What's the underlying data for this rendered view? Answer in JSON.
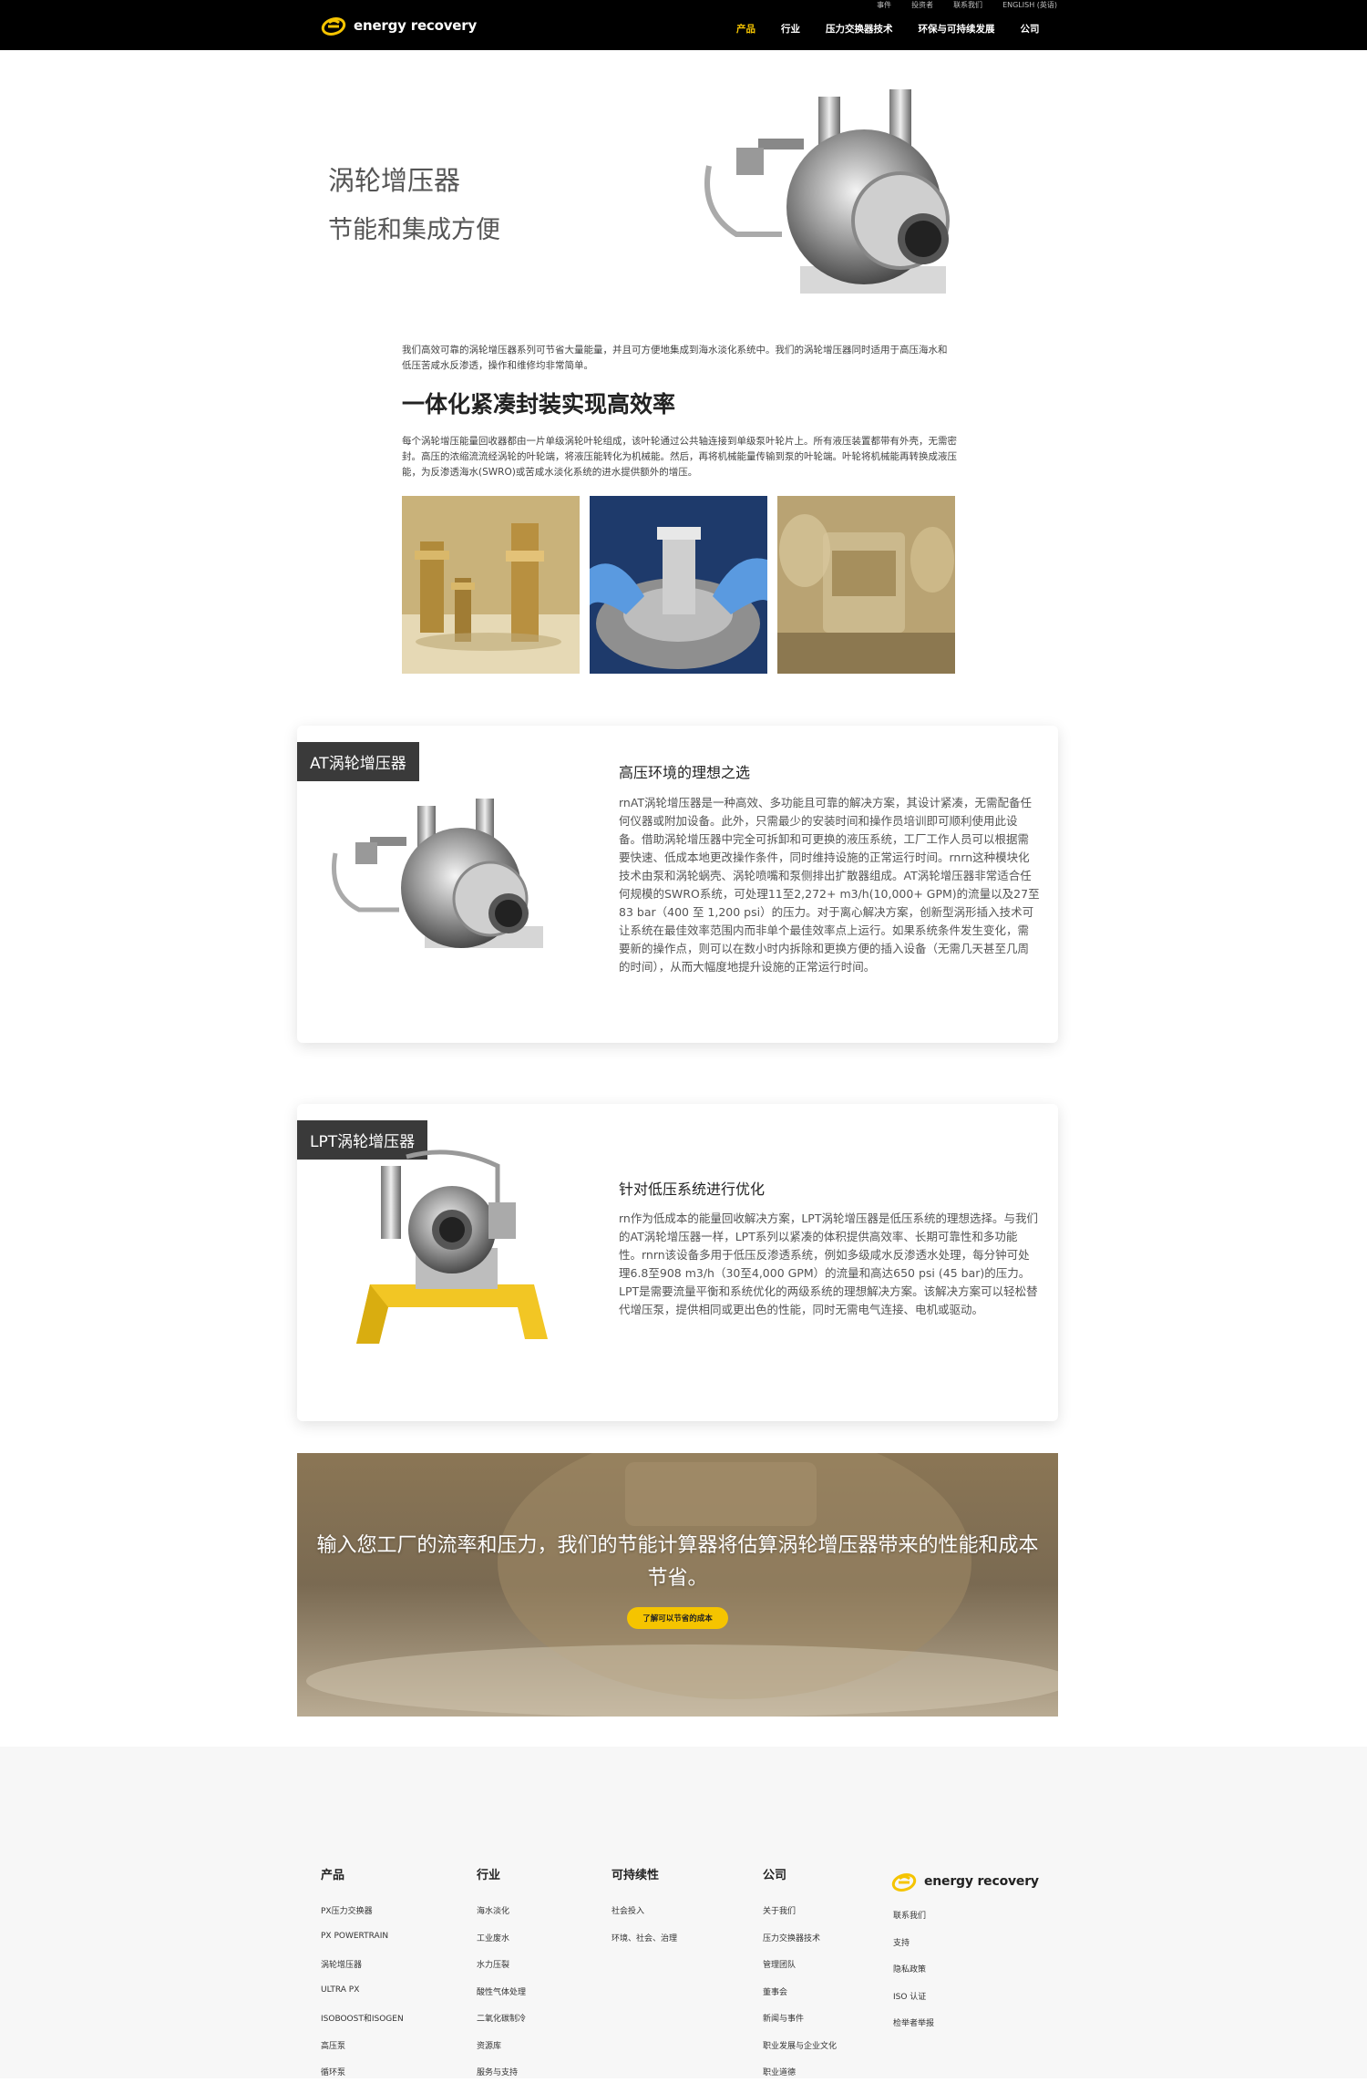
{
  "header": {
    "utility": [
      "事件",
      "投资者",
      "联系我们",
      "ENGLISH (英语)"
    ],
    "logo_text": "energy recovery",
    "nav": [
      {
        "label": "产品",
        "active": true
      },
      {
        "label": "行业",
        "active": false
      },
      {
        "label": "压力交换器技术",
        "active": false
      },
      {
        "label": "环保与可持续发展",
        "active": false
      },
      {
        "label": "公司",
        "active": false
      }
    ]
  },
  "hero": {
    "title": "涡轮增压器",
    "subtitle": "节能和集成方便"
  },
  "intro": "我们高效可靠的涡轮增压器系列可节省大量能量，并且可方便地集成到海水淡化系统中。我们的涡轮增压器同时适用于高压海水和低压苦咸水反渗透，操作和维修均非常简单。",
  "section": {
    "heading": "一体化紧凑封装实现高效率",
    "body": "每个涡轮增压能量回收器都由一片单级涡轮叶轮组成，该叶轮通过公共轴连接到单级泵叶轮片上。所有液压装置都带有外壳，无需密封。高压的浓缩流流经涡轮的叶轮端，将液压能转化为机械能。然后，再将机械能量传输到泵的叶轮端。叶轮将机械能再转换成液压能，为反渗透海水(SWRO)或苦咸水淡化系统的进水提供额外的增压。"
  },
  "cards": [
    {
      "tag": "AT涡轮增压器",
      "heading": "高压环境的理想之选",
      "body": "rnAT涡轮增压器是一种高效、多功能且可靠的解决方案，其设计紧凑，无需配备任何仪器或附加设备。此外，只需最少的安装时间和操作员培训即可顺利使用此设备。借助涡轮增压器中完全可拆卸和可更换的液压系统，工厂工作人员可以根据需要快速、低成本地更改操作条件，同时维持设施的正常运行时间。rnrn这种模块化技术由泵和涡轮蜗壳、涡轮喷嘴和泵侧排出扩散器组成。AT涡轮增压器非常适合任何规模的SWRO系统，可处理11至2,272+ m3/h(10,000+ GPM)的流量以及27至83 bar（400 至 1,200 psi）的压力。对于离心解决方案，创新型涡形插入技术可让系统在最佳效率范围内而非单个最佳效率点上运行。如果系统条件发生变化，需要新的操作点，则可以在数小时内拆除和更换方便的插入设备（无需几天甚至几周的时间），从而大幅度地提升设施的正常运行时间。"
    },
    {
      "tag": "LPT涡轮增压器",
      "heading": "针对低压系统进行优化",
      "body": "rn作为低成本的能量回收解决方案，LPT涡轮增压器是低压系统的理想选择。与我们的AT涡轮增压器一样，LPT系列以紧凑的体积提供高效率、长期可靠性和多功能性。rnrn该设备多用于低压反渗透系统，例如多级咸水反渗透水处理，每分钟可处理6.8至908 m3/h（30至4,000 GPM）的流量和高达650 psi (45 bar)的压力。LPT是需要流量平衡和系统优化的两级系统的理想解决方案。该解决方案可以轻松替代增压泵，提供相同或更出色的性能，同时无需电气连接、电机或驱动。"
    }
  ],
  "banner": {
    "text": "输入您工厂的流率和压力，我们的节能计算器将估算涡轮增压器带来的性能和成本节省。",
    "button": "了解可以节省的成本"
  },
  "footer": {
    "columns": [
      {
        "title": "产品",
        "items": [
          "PX压力交换器",
          "PX POWERTRAIN",
          "涡轮增压器",
          "ULTRA PX",
          "ISOBOOST和ISOGEN",
          "高压泵",
          "循环泵"
        ]
      },
      {
        "title": "行业",
        "items": [
          "海水淡化",
          "工业废水",
          "水力压裂",
          "酸性气体处理",
          "二氧化碳制冷",
          "资源库",
          "服务与支持"
        ]
      },
      {
        "title": "可持续性",
        "items": [
          "社会投入",
          "环境、社会、治理"
        ]
      },
      {
        "title": "公司",
        "items": [
          "关于我们",
          "压力交换器技术",
          "管理团队",
          "董事会",
          "新闻与事件",
          "职业发展与企业文化",
          "职业道德"
        ]
      }
    ],
    "logo_text": "energy recovery",
    "contact": [
      "联系我们",
      "支持",
      "隐私政策",
      "ISO 认证",
      "检举者举报"
    ]
  },
  "colors": {
    "accent": "#f5c400",
    "header_bg": "#000000",
    "tag_bg": "#3a3a3a",
    "footer_bg": "#f7f7f7"
  }
}
